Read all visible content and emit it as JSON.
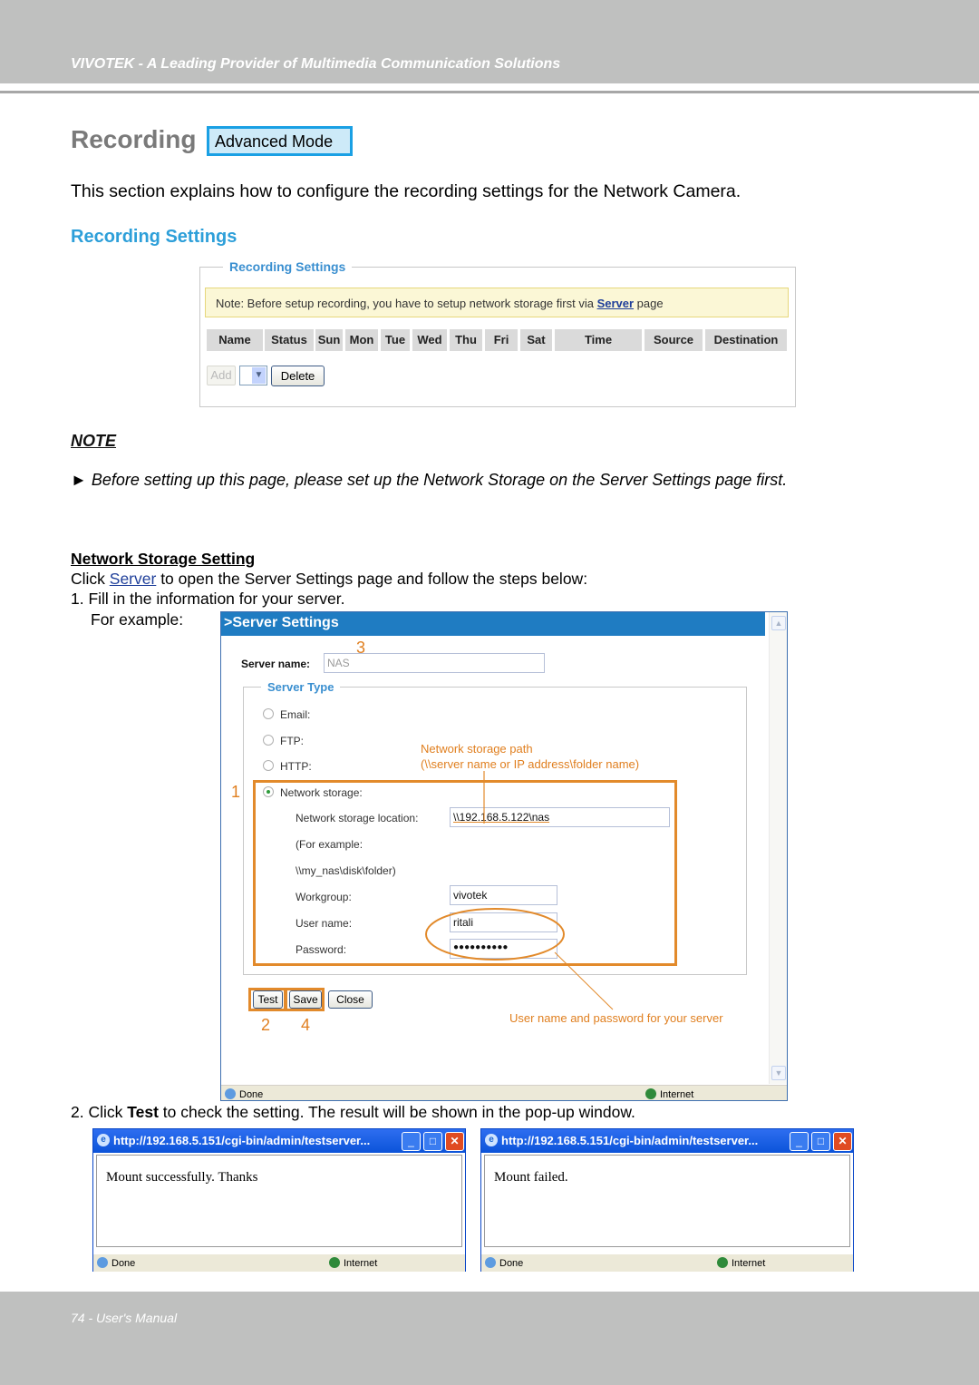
{
  "header": {
    "tagline": "VIVOTEK - A Leading Provider of Multimedia Communication Solutions"
  },
  "page": {
    "title": "Recording",
    "mode_badge": "Advanced Mode",
    "intro": "This section explains how to configure the recording settings for the Network Camera.",
    "subheading": "Recording Settings"
  },
  "recording_settings": {
    "legend": "Recording Settings",
    "note_prefix": "Note: Before setup recording, you have to setup network storage first via ",
    "note_link": "Server",
    "note_suffix": " page",
    "columns": [
      "Name",
      "Status",
      "Sun",
      "Mon",
      "Tue",
      "Wed",
      "Thu",
      "Fri",
      "Sat",
      "Time",
      "Source",
      "Destination"
    ],
    "add_label": "Add",
    "delete_label": "Delete",
    "dropdown_arrow": "chevron-down-icon"
  },
  "note": {
    "label": "NOTE",
    "bullet": "►",
    "text": "Before setting up this page, please set up the Network Storage on the Server Settings page first."
  },
  "network_storage": {
    "heading": "Network Storage Setting",
    "line1_prefix": "Click ",
    "line1_link": "Server",
    "line1_suffix": " to open the Server Settings page and follow the steps below:",
    "step1": "1. Fill in the information for your server.",
    "for_example": "For example:",
    "step2_prefix": "2. Click ",
    "step2_bold": "Test",
    "step2_suffix": " to check the setting. The result will be shown in the pop-up window."
  },
  "server_settings": {
    "title": ">Server Settings",
    "server_name_label": "Server name:",
    "server_name_value": "NAS",
    "server_type_legend": "Server Type",
    "types": [
      "Email:",
      "FTP:",
      "HTTP:",
      "Network storage:"
    ],
    "selected_type": "Network storage:",
    "location_label": "Network storage location:",
    "location_value": "\\\\192.168.5.122\\nas",
    "example_line1": "(For example:",
    "example_line2": "\\\\my_nas\\disk\\folder)",
    "workgroup_label": "Workgroup:",
    "workgroup_value": "vivotek",
    "username_label": "User name:",
    "username_value": "ritali",
    "password_label": "Password:",
    "password_value": "●●●●●●●●●●",
    "buttons": {
      "test": "Test",
      "save": "Save",
      "close": "Close"
    },
    "status_done": "Done",
    "status_zone": "Internet",
    "callouts": {
      "n1": "1",
      "n2": "2",
      "n3": "3",
      "n4": "4",
      "path_line1": "Network storage path",
      "path_line2": "(\\\\server name or IP address\\folder name)",
      "credentials": "User name and password for your server"
    },
    "accent_color": "#e28a2b"
  },
  "popups": [
    {
      "title": "http://192.168.5.151/cgi-bin/admin/testserver...",
      "message": "Mount successfully. Thanks",
      "status_done": "Done",
      "status_zone": "Internet"
    },
    {
      "title": "http://192.168.5.151/cgi-bin/admin/testserver...",
      "message": "Mount failed.",
      "status_done": "Done",
      "status_zone": "Internet"
    }
  ],
  "footer": {
    "page_label": "74 - User's Manual"
  }
}
